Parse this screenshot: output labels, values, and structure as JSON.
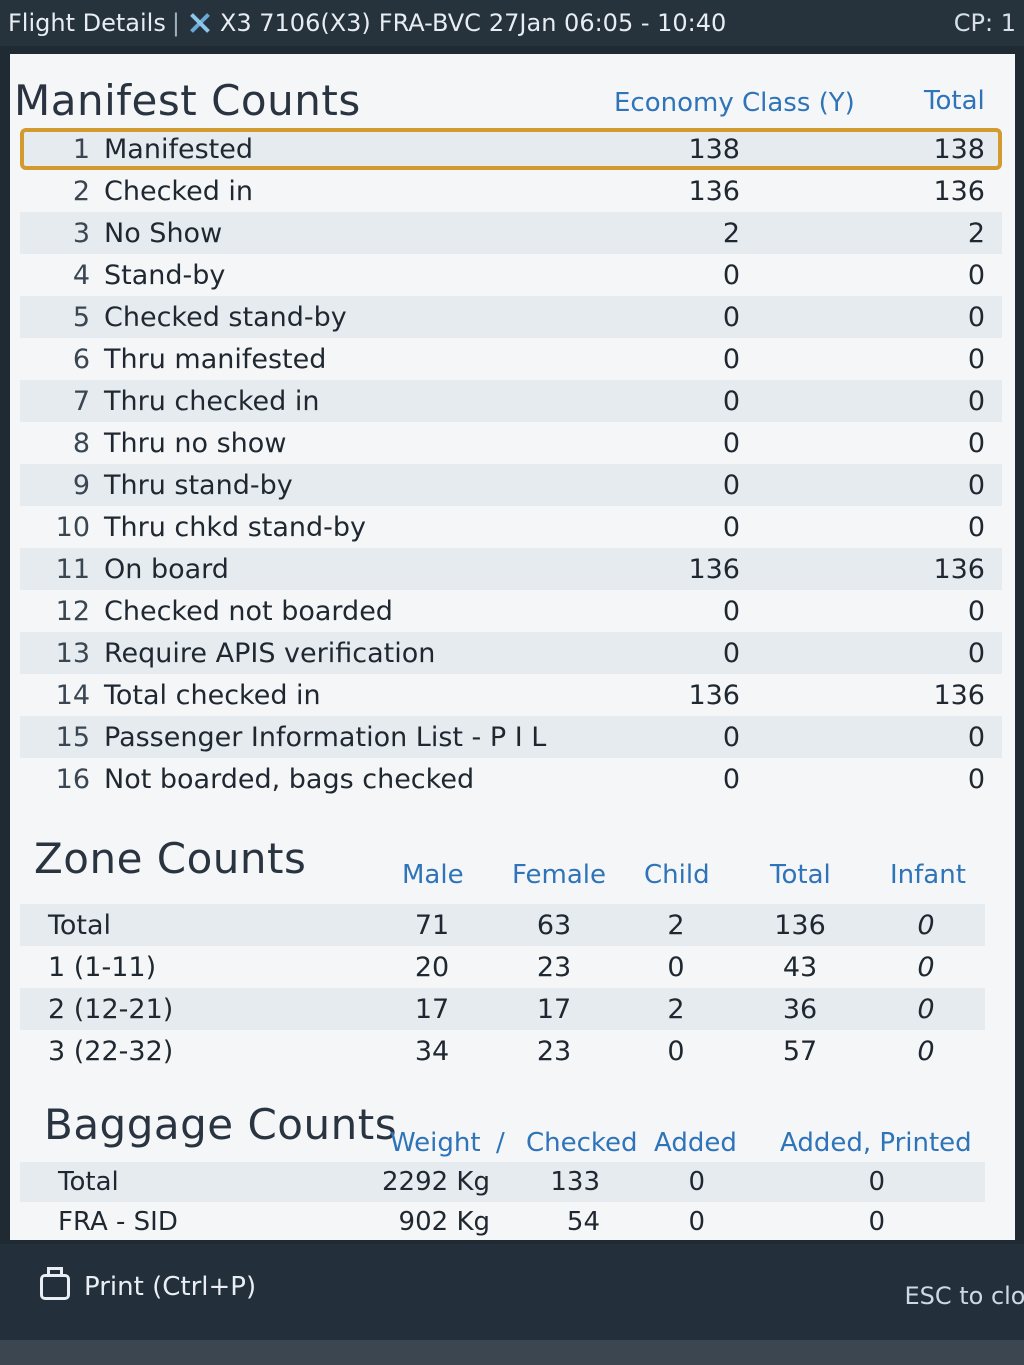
{
  "title_bar": {
    "label": "Flight Details",
    "flight": "X3 7106(X3)",
    "route": "FRA-BVC",
    "date_time": "27Jan 06:05 - 10:40",
    "right": "CP: 1"
  },
  "manifest": {
    "title": "Manifest Counts",
    "headers": {
      "economy": "Economy Class (Y)",
      "total": "Total"
    },
    "rows": [
      {
        "num": "1",
        "label": "Manifested",
        "economy": "138",
        "total": "138"
      },
      {
        "num": "2",
        "label": "Checked in",
        "economy": "136",
        "total": "136"
      },
      {
        "num": "3",
        "label": "No Show",
        "economy": "2",
        "total": "2"
      },
      {
        "num": "4",
        "label": "Stand-by",
        "economy": "0",
        "total": "0"
      },
      {
        "num": "5",
        "label": "Checked stand-by",
        "economy": "0",
        "total": "0"
      },
      {
        "num": "6",
        "label": "Thru manifested",
        "economy": "0",
        "total": "0"
      },
      {
        "num": "7",
        "label": "Thru checked in",
        "economy": "0",
        "total": "0"
      },
      {
        "num": "8",
        "label": "Thru no show",
        "economy": "0",
        "total": "0"
      },
      {
        "num": "9",
        "label": "Thru stand-by",
        "economy": "0",
        "total": "0"
      },
      {
        "num": "10",
        "label": "Thru chkd stand-by",
        "economy": "0",
        "total": "0"
      },
      {
        "num": "11",
        "label": "On board",
        "economy": "136",
        "total": "136"
      },
      {
        "num": "12",
        "label": "Checked not boarded",
        "economy": "0",
        "total": "0"
      },
      {
        "num": "13",
        "label": "Require APIS verification",
        "economy": "0",
        "total": "0"
      },
      {
        "num": "14",
        "label": "Total checked in",
        "economy": "136",
        "total": "136"
      },
      {
        "num": "15",
        "label": "Passenger Information List - P I L",
        "economy": "0",
        "total": "0"
      },
      {
        "num": "16",
        "label": "Not boarded, bags checked",
        "economy": "0",
        "total": "0"
      }
    ]
  },
  "zones": {
    "title": "Zone Counts",
    "headers": {
      "male": "Male",
      "female": "Female",
      "child": "Child",
      "total": "Total",
      "infant": "Infant"
    },
    "rows": [
      {
        "label": "Total",
        "male": "71",
        "female": "63",
        "child": "2",
        "total": "136",
        "infant": "0"
      },
      {
        "label": "1 (1-11)",
        "male": "20",
        "female": "23",
        "child": "0",
        "total": "43",
        "infant": "0"
      },
      {
        "label": "2 (12-21)",
        "male": "17",
        "female": "17",
        "child": "2",
        "total": "36",
        "infant": "0"
      },
      {
        "label": "3 (22-32)",
        "male": "34",
        "female": "23",
        "child": "0",
        "total": "57",
        "infant": "0"
      }
    ]
  },
  "baggage": {
    "title": "Baggage Counts",
    "headers": {
      "weight": "Weight",
      "slash": "/",
      "checked": "Checked",
      "added": "Added",
      "added_printed": "Added, Printed"
    },
    "rows": [
      {
        "label": "Total",
        "weight": "2292 Kg",
        "checked": "133",
        "added": "0",
        "added_printed": "0"
      },
      {
        "label": "FRA - SID",
        "weight": "902 Kg",
        "checked": "54",
        "added": "0",
        "added_printed": "0"
      }
    ]
  },
  "footer": {
    "print_label": "Print (Ctrl+P)",
    "esc_label": "ESC to clos"
  },
  "colors": {
    "accent": "#2f73b8",
    "selection": "#d39b2f"
  }
}
